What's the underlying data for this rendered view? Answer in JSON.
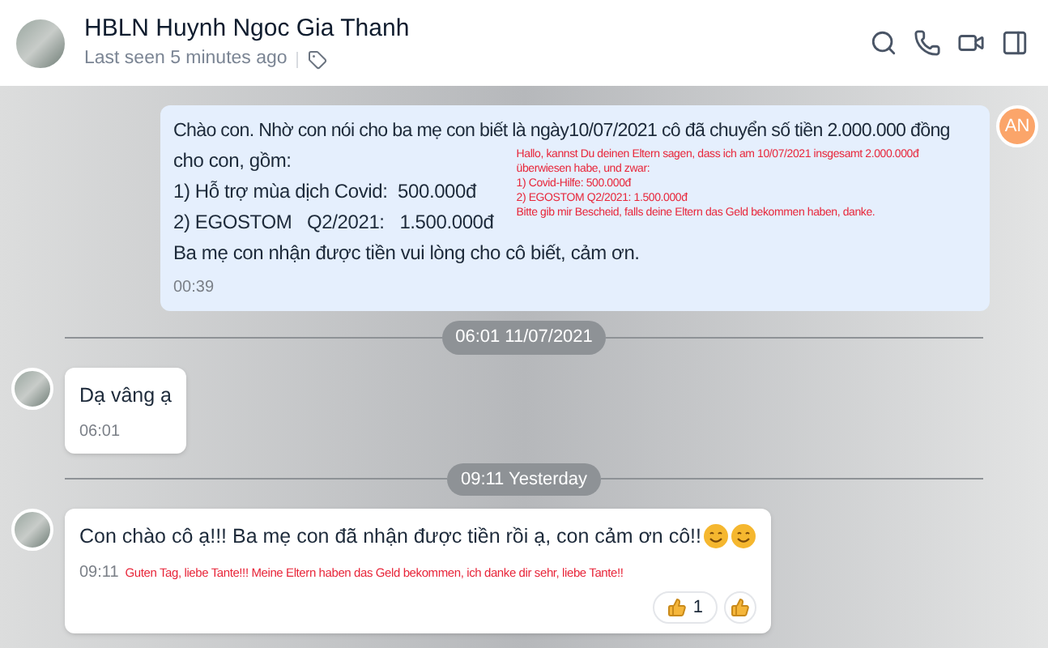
{
  "header": {
    "name": "HBLN Huynh Ngoc Gia Thanh",
    "status": "Last seen 5 minutes ago"
  },
  "messages": [
    {
      "kind": "outgoing",
      "initials": "AN",
      "first_line": "Chào con. Nhờ con nói cho ba mẹ con biết là ngày10/07/2021 cô đã chuyển số tiền 2.000.000 đồng",
      "lines": [
        "cho con, gồm:",
        "1) Hỗ trợ mùa dịch Covid:  500.000đ",
        "2) EGOSTOM   Q2/2021:   1.500.000đ",
        "Ba mẹ con nhận được tiền vui lòng cho cô biết, cảm ơn."
      ],
      "translation_lines": [
        "Hallo, kannst Du deinen Eltern sagen, dass ich am 10/07/2021 insgesamt 2.000.000đ",
        "überwiesen habe, und zwar:",
        "1) Covid-Hilfe: 500.000đ",
        "2) EGOSTOM Q2/2021: 1.500.000đ",
        "Bitte gib mir Bescheid, falls deine Eltern das Geld bekommen haben, danke."
      ],
      "time": "00:39"
    },
    {
      "kind": "divider",
      "label": "06:01 11/07/2021"
    },
    {
      "kind": "incoming",
      "text": "Dạ vâng ạ",
      "time": "06:01"
    },
    {
      "kind": "divider",
      "label": "09:11 Yesterday"
    },
    {
      "kind": "incoming",
      "text": "Con chào cô ạ!!! Ba mẹ con đã nhận được tiền rồi ạ, con cảm ơn cô!!",
      "smileys": true,
      "time": "09:11",
      "translation": "Guten Tag, liebe Tante!!! Meine Eltern haben das Geld bekommen, ich danke dir sehr, liebe Tante!!",
      "reactions": [
        {
          "kind": "count",
          "count": "1"
        },
        {
          "kind": "add"
        }
      ]
    }
  ]
}
